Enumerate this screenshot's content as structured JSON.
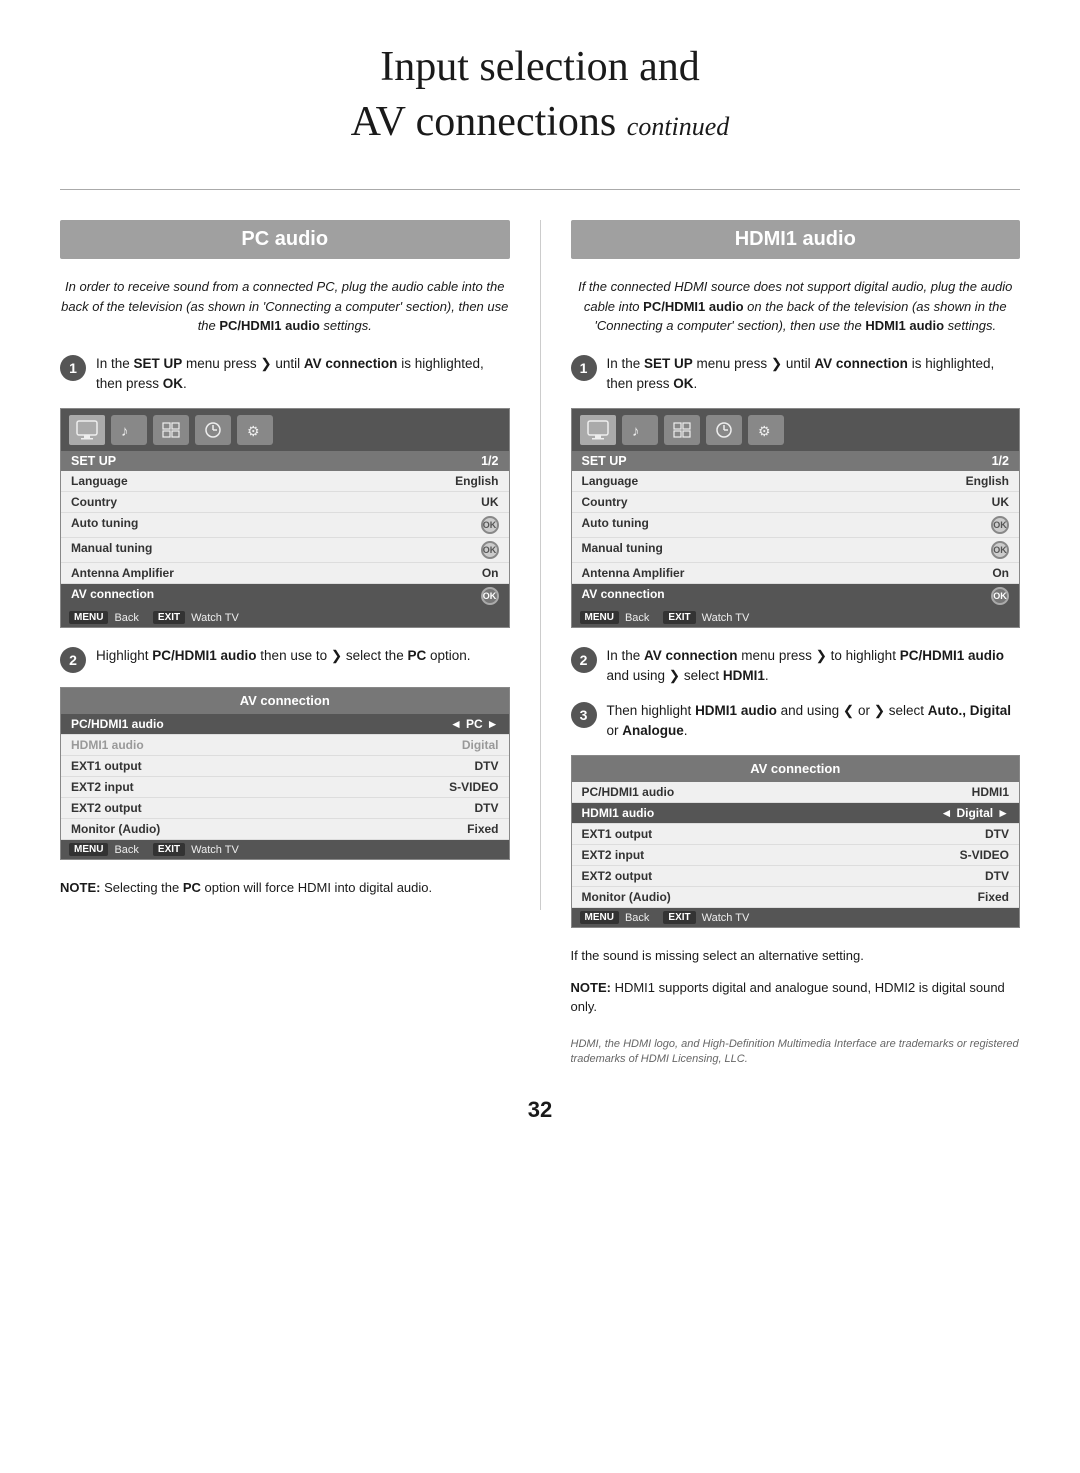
{
  "page": {
    "title_line1": "Input selection and",
    "title_line2": "AV connections",
    "title_continued": "continued",
    "page_number": "32"
  },
  "left_section": {
    "header": "PC audio",
    "intro": "In order to receive sound from a connected PC, plug the audio cable into the back of the television (as shown in 'Connecting a computer' section), then use the",
    "intro_bold": "PC/HDMI1 audio",
    "intro_end": "settings.",
    "step1_text": "In the",
    "step1_bold1": "SET UP",
    "step1_mid": "menu press",
    "step1_bold2": "AV connection",
    "step1_end": "is highlighted, then press",
    "step1_ok": "OK.",
    "setup_menu": {
      "title": "SET UP",
      "page": "1/2",
      "rows": [
        {
          "label": "Language",
          "value": "English",
          "highlighted": false,
          "ok": false
        },
        {
          "label": "Country",
          "value": "UK",
          "highlighted": false,
          "ok": false
        },
        {
          "label": "Auto tuning",
          "value": "",
          "highlighted": false,
          "ok": true
        },
        {
          "label": "Manual tuning",
          "value": "",
          "highlighted": false,
          "ok": true
        },
        {
          "label": "Antenna Amplifier",
          "value": "On",
          "highlighted": false,
          "ok": false
        },
        {
          "label": "AV connection",
          "value": "",
          "highlighted": true,
          "ok": true
        }
      ],
      "footer_back": "Back",
      "footer_watch": "Watch TV",
      "menu_btn": "MENU",
      "exit_btn": "EXIT"
    },
    "step2_text": "Highlight",
    "step2_bold1": "PC/HDMI1 audio",
    "step2_mid": "then use to",
    "step2_select": "❯",
    "step2_mid2": "select the",
    "step2_bold2": "PC",
    "step2_end": "option.",
    "av_connection": {
      "title": "AV connection",
      "rows": [
        {
          "label": "PC/HDMI1 audio",
          "value": "PC",
          "highlighted": true,
          "has_arrows": true
        },
        {
          "label": "HDMI1 audio",
          "value": "Digital",
          "highlighted": false,
          "has_arrows": false,
          "dimmed": true
        },
        {
          "label": "EXT1 output",
          "value": "DTV",
          "highlighted": false
        },
        {
          "label": "EXT2 input",
          "value": "S-VIDEO",
          "highlighted": false
        },
        {
          "label": "EXT2 output",
          "value": "DTV",
          "highlighted": false
        },
        {
          "label": "Monitor (Audio)",
          "value": "Fixed",
          "highlighted": false
        }
      ],
      "footer_back": "Back",
      "footer_watch": "Watch TV",
      "menu_btn": "MENU",
      "exit_btn": "EXIT"
    },
    "note_bold": "NOTE:",
    "note_text": "Selecting the",
    "note_pc": "PC",
    "note_end": "option will force HDMI into digital audio."
  },
  "right_section": {
    "header": "HDMI1 audio",
    "intro": "If the connected HDMI source does not support digital audio, plug the audio cable into",
    "intro_bold": "PC/HDMI1 audio",
    "intro_mid": "on the back of the television (as shown in the 'Connecting a computer' section), then use the",
    "intro_bold2": "HDMI1 audio",
    "intro_end": "settings.",
    "step1_text": "In the",
    "step1_bold1": "SET UP",
    "step1_mid": "menu press",
    "step1_bold2": "AV connection",
    "step1_end": "is highlighted, then press",
    "step1_ok": "OK.",
    "setup_menu": {
      "title": "SET UP",
      "page": "1/2",
      "rows": [
        {
          "label": "Language",
          "value": "English",
          "highlighted": false,
          "ok": false
        },
        {
          "label": "Country",
          "value": "UK",
          "highlighted": false,
          "ok": false
        },
        {
          "label": "Auto tuning",
          "value": "",
          "highlighted": false,
          "ok": true
        },
        {
          "label": "Manual tuning",
          "value": "",
          "highlighted": false,
          "ok": true
        },
        {
          "label": "Antenna Amplifier",
          "value": "On",
          "highlighted": false,
          "ok": false
        },
        {
          "label": "AV connection",
          "value": "",
          "highlighted": true,
          "ok": true
        }
      ],
      "footer_back": "Back",
      "footer_watch": "Watch TV",
      "menu_btn": "MENU",
      "exit_btn": "EXIT"
    },
    "step2_text": "In the",
    "step2_bold1": "AV connection",
    "step2_mid": "menu press",
    "step2_arrow": "❯",
    "step2_bold2": "PC/HDMI1 audio",
    "step2_mid2": "and using",
    "step2_select": "❯",
    "step2_end": "select HDMI1.",
    "step3_text": "Then highlight",
    "step3_bold1": "HDMI1 audio",
    "step3_mid": "and using",
    "step3_options": "Auto., Digital or Analogue.",
    "av_connection": {
      "title": "AV connection",
      "rows": [
        {
          "label": "PC/HDMI1 audio",
          "value": "HDMI1",
          "highlighted": false,
          "has_arrows": false
        },
        {
          "label": "HDMI1 audio",
          "value": "Digital",
          "highlighted": true,
          "has_arrows": true
        },
        {
          "label": "EXT1 output",
          "value": "DTV",
          "highlighted": false
        },
        {
          "label": "EXT2 input",
          "value": "S-VIDEO",
          "highlighted": false
        },
        {
          "label": "EXT2 output",
          "value": "DTV",
          "highlighted": false
        },
        {
          "label": "Monitor (Audio)",
          "value": "Fixed",
          "highlighted": false
        }
      ],
      "footer_back": "Back",
      "footer_watch": "Watch TV",
      "menu_btn": "MENU",
      "exit_btn": "EXIT"
    },
    "note1_text": "If the sound is missing select an alternative setting.",
    "note2_bold": "NOTE:",
    "note2_text": "HDMI1 supports digital and analogue sound, HDMI2 is digital sound only.",
    "footer_note": "HDMI, the HDMI logo, and High-Definition Multimedia Interface are trademarks or registered trademarks of HDMI Licensing, LLC."
  }
}
